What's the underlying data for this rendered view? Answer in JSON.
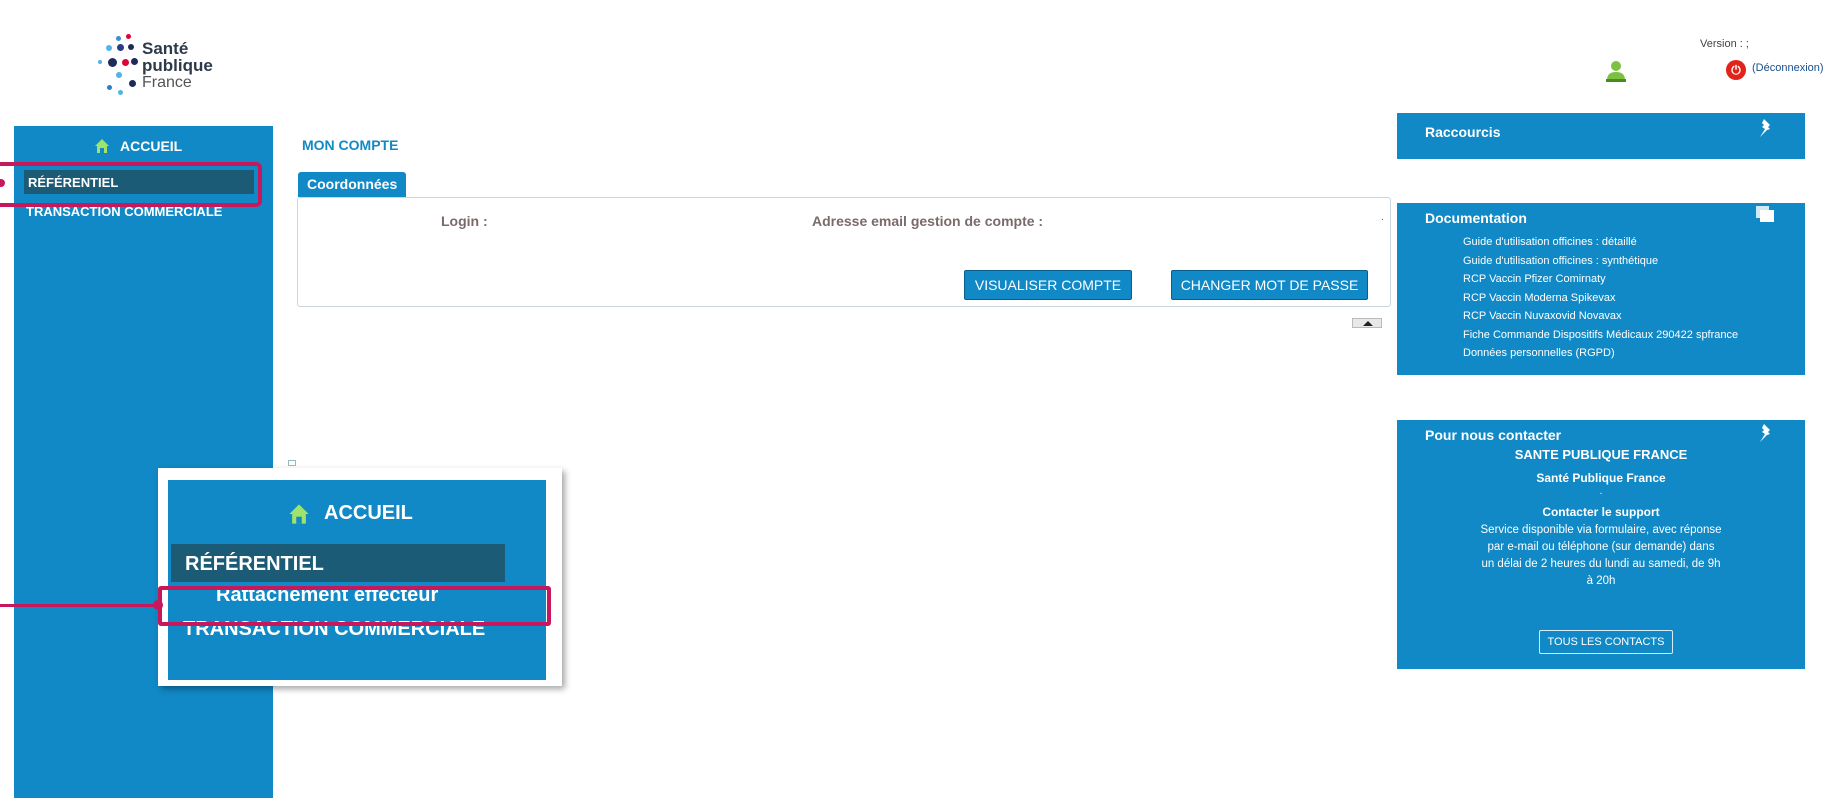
{
  "logo": {
    "line1": "Santé",
    "line2": "publique",
    "line3": "France"
  },
  "header": {
    "version_label": "Version : ;",
    "logout_label": "(Déconnexion)"
  },
  "sidebar": {
    "home_label": "ACCUEIL",
    "items": [
      {
        "label": "RÉFÉRENTIEL"
      },
      {
        "label": "TRANSACTION COMMERCIALE"
      }
    ]
  },
  "main": {
    "title": "MON COMPTE",
    "tab_label": "Coordonnées",
    "login_label": "Login :",
    "email_label": "Adresse email gestion de compte :",
    "dot": ".",
    "view_account_button": "VISUALISER COMPTE",
    "change_password_button": "CHANGER MOT DE PASSE"
  },
  "shortcuts": {
    "title": "Raccourcis"
  },
  "documentation": {
    "title": "Documentation",
    "links": [
      "Guide d'utilisation officines : détaillé",
      "Guide d'utilisation officines : synthétique",
      "RCP Vaccin Pfizer Comirnaty",
      "RCP Vaccin Moderna Spikevax",
      "RCP Vaccin Nuvaxovid Novavax",
      "Fiche Commande Dispositifs Médicaux 290422 spfrance",
      "Données personnelles (RGPD)"
    ]
  },
  "contact": {
    "title": "Pour nous contacter",
    "org_upper": "SANTE PUBLIQUE FRANCE",
    "org": "Santé Publique France",
    "dot": ".",
    "support_title": "Contacter le support",
    "support_text_1": "Service disponible via formulaire, avec réponse",
    "support_text_2": "par e-mail ou téléphone (sur demande) dans",
    "support_text_3": "un délai de 2 heures du lundi au samedi, de 9h",
    "support_text_4": "à 20h",
    "all_contacts_button": "TOUS LES CONTACTS"
  },
  "zoom": {
    "home_label": "ACCUEIL",
    "ref_label": "RÉFÉRENTIEL",
    "sub_item_label": "Rattachement effecteur",
    "trans_label": "TRANSACTION COMMERCIALE"
  },
  "colors": {
    "primary": "#1089c6",
    "active_item": "#1c5b76",
    "highlight": "#c8185c"
  }
}
